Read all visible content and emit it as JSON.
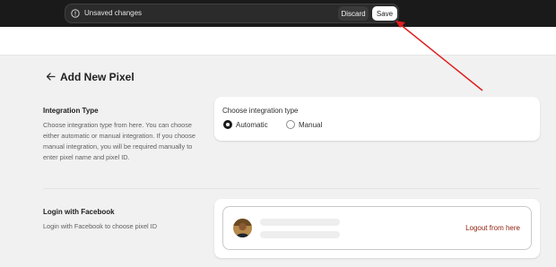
{
  "save_bar": {
    "message": "Unsaved changes",
    "discard_label": "Discard",
    "save_label": "Save"
  },
  "page": {
    "title": "Add New Pixel"
  },
  "integration": {
    "title": "Integration Type",
    "description": "Choose integration type from here. You can choose either automatic or manual integration. If you choose manual integration, you will be required manually to enter pixel name and pixel ID.",
    "card_label": "Choose integration type",
    "options": [
      {
        "label": "Automatic",
        "selected": true
      },
      {
        "label": "Manual",
        "selected": false
      }
    ]
  },
  "facebook": {
    "title": "Login with Facebook",
    "description": "Login with Facebook to choose pixel ID",
    "logout_label": "Logout from here"
  },
  "colors": {
    "topbar": "#1a1a1a",
    "logout_link": "#8e1f0b",
    "annotation_arrow": "#e02020"
  },
  "icons": [
    "info-icon",
    "back-arrow-icon",
    "avatar"
  ]
}
